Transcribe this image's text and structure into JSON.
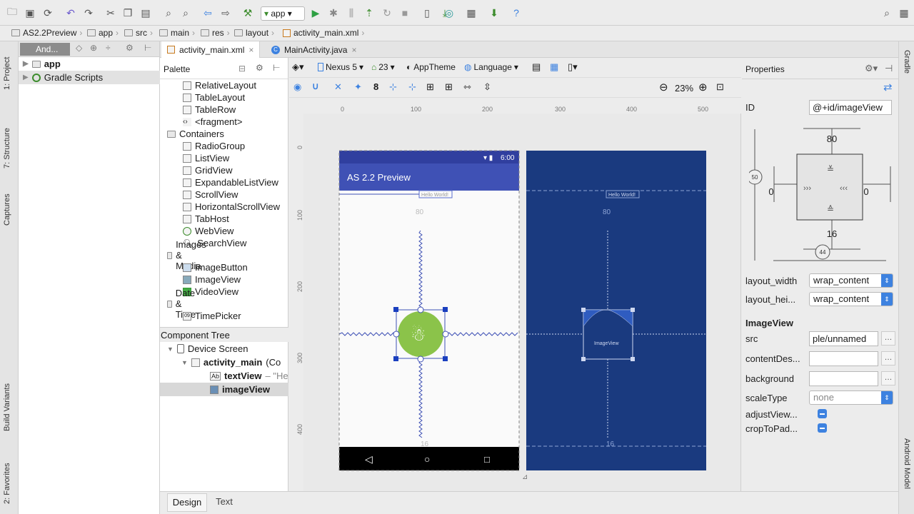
{
  "toolbar": {
    "run_config": "app",
    "icons": [
      "open-folder",
      "save",
      "sync",
      "undo",
      "redo",
      "cut",
      "copy",
      "paste",
      "find",
      "replace",
      "back",
      "forward",
      "make",
      "run",
      "debug",
      "attach",
      "apply",
      "sync-gradle",
      "stop",
      "avd-manager",
      "sdk-manager",
      "project-structure",
      "help",
      "search"
    ]
  },
  "breadcrumb": [
    "AS2.2Preview",
    "app",
    "src",
    "main",
    "res",
    "layout",
    "activity_main.xml"
  ],
  "left_strip": [
    "1: Project",
    "7: Structure",
    "Captures",
    "Build Variants",
    "2: Favorites"
  ],
  "right_strip": [
    "Gradle",
    "Android Model"
  ],
  "project": {
    "view_label": "And...",
    "items": [
      "app",
      "Gradle Scripts"
    ]
  },
  "tabs": [
    {
      "label": "activity_main.xml"
    },
    {
      "label": "MainActivity.java"
    }
  ],
  "palette": {
    "title": "Palette",
    "items_a": [
      "RelativeLayout",
      "TableLayout",
      "TableRow",
      "<fragment>"
    ],
    "cat_containers": "Containers",
    "items_b": [
      "RadioGroup",
      "ListView",
      "GridView",
      "ExpandableListView",
      "ScrollView",
      "HorizontalScrollView",
      "TabHost",
      "WebView",
      "SearchView"
    ],
    "cat_images": "Images & Media",
    "items_c": [
      "ImageButton",
      "ImageView",
      "VideoView"
    ],
    "cat_date": "Date & Time",
    "items_d": [
      "TimePicker"
    ]
  },
  "component_tree": {
    "title": "Component Tree",
    "device": "Device Screen",
    "root": "activity_main",
    "root_suffix": "(Co",
    "textview": "textView",
    "textview_hint": "– \"He",
    "imageview": "imageView"
  },
  "canvas_toolbar": {
    "device": "Nexus 5",
    "api": "23",
    "theme": "AppTheme",
    "language": "Language",
    "margin": "8",
    "zoom": "23%"
  },
  "ruler": {
    "h": [
      "0",
      "100",
      "200",
      "300",
      "400",
      "500"
    ],
    "v": [
      "0",
      "100",
      "200",
      "300",
      "400"
    ]
  },
  "design": {
    "app_title": "AS 2.2 Preview",
    "clock": "6:00",
    "hello": "Hello World!",
    "margin_top": "80",
    "margin_bottom": "16",
    "blueprint_image_label": "ImageView"
  },
  "properties": {
    "title": "Properties",
    "id_label": "ID",
    "id_value": "@+id/imageView",
    "inspector": {
      "top": "80",
      "left": "0",
      "right": "0",
      "bottom": "16",
      "vbias": "50",
      "hbias": "44"
    },
    "layout_width_label": "layout_width",
    "layout_width": "wrap_content",
    "layout_height_label": "layout_hei...",
    "layout_height": "wrap_content",
    "section": "ImageView",
    "src_label": "src",
    "src_value": "ple/unnamed",
    "contentdesc_label": "contentDes...",
    "background_label": "background",
    "scaletype_label": "scaleType",
    "scaletype": "none",
    "adjust_label": "adjustView...",
    "crop_label": "cropToPad..."
  },
  "bottom_tabs": {
    "design": "Design",
    "text": "Text"
  },
  "colors": {
    "app_bar": "#3f51b5",
    "blueprint": "#1a3a7f",
    "android_green": "#8bc34a",
    "accent": "#3d82e0"
  }
}
